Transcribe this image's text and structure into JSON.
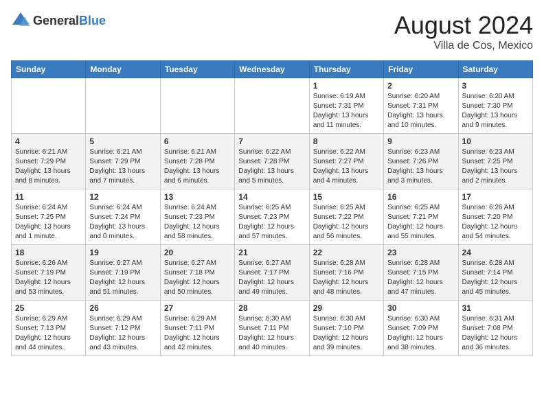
{
  "header": {
    "logo_general": "General",
    "logo_blue": "Blue",
    "title": "August 2024",
    "subtitle": "Villa de Cos, Mexico"
  },
  "days_of_week": [
    "Sunday",
    "Monday",
    "Tuesday",
    "Wednesday",
    "Thursday",
    "Friday",
    "Saturday"
  ],
  "weeks": [
    [
      {
        "day": "",
        "info": ""
      },
      {
        "day": "",
        "info": ""
      },
      {
        "day": "",
        "info": ""
      },
      {
        "day": "",
        "info": ""
      },
      {
        "day": "1",
        "info": "Sunrise: 6:19 AM\nSunset: 7:31 PM\nDaylight: 13 hours and 11 minutes."
      },
      {
        "day": "2",
        "info": "Sunrise: 6:20 AM\nSunset: 7:31 PM\nDaylight: 13 hours and 10 minutes."
      },
      {
        "day": "3",
        "info": "Sunrise: 6:20 AM\nSunset: 7:30 PM\nDaylight: 13 hours and 9 minutes."
      }
    ],
    [
      {
        "day": "4",
        "info": "Sunrise: 6:21 AM\nSunset: 7:29 PM\nDaylight: 13 hours and 8 minutes."
      },
      {
        "day": "5",
        "info": "Sunrise: 6:21 AM\nSunset: 7:29 PM\nDaylight: 13 hours and 7 minutes."
      },
      {
        "day": "6",
        "info": "Sunrise: 6:21 AM\nSunset: 7:28 PM\nDaylight: 13 hours and 6 minutes."
      },
      {
        "day": "7",
        "info": "Sunrise: 6:22 AM\nSunset: 7:28 PM\nDaylight: 13 hours and 5 minutes."
      },
      {
        "day": "8",
        "info": "Sunrise: 6:22 AM\nSunset: 7:27 PM\nDaylight: 13 hours and 4 minutes."
      },
      {
        "day": "9",
        "info": "Sunrise: 6:23 AM\nSunset: 7:26 PM\nDaylight: 13 hours and 3 minutes."
      },
      {
        "day": "10",
        "info": "Sunrise: 6:23 AM\nSunset: 7:25 PM\nDaylight: 13 hours and 2 minutes."
      }
    ],
    [
      {
        "day": "11",
        "info": "Sunrise: 6:24 AM\nSunset: 7:25 PM\nDaylight: 13 hours and 1 minute."
      },
      {
        "day": "12",
        "info": "Sunrise: 6:24 AM\nSunset: 7:24 PM\nDaylight: 13 hours and 0 minutes."
      },
      {
        "day": "13",
        "info": "Sunrise: 6:24 AM\nSunset: 7:23 PM\nDaylight: 12 hours and 58 minutes."
      },
      {
        "day": "14",
        "info": "Sunrise: 6:25 AM\nSunset: 7:23 PM\nDaylight: 12 hours and 57 minutes."
      },
      {
        "day": "15",
        "info": "Sunrise: 6:25 AM\nSunset: 7:22 PM\nDaylight: 12 hours and 56 minutes."
      },
      {
        "day": "16",
        "info": "Sunrise: 6:25 AM\nSunset: 7:21 PM\nDaylight: 12 hours and 55 minutes."
      },
      {
        "day": "17",
        "info": "Sunrise: 6:26 AM\nSunset: 7:20 PM\nDaylight: 12 hours and 54 minutes."
      }
    ],
    [
      {
        "day": "18",
        "info": "Sunrise: 6:26 AM\nSunset: 7:19 PM\nDaylight: 12 hours and 53 minutes."
      },
      {
        "day": "19",
        "info": "Sunrise: 6:27 AM\nSunset: 7:19 PM\nDaylight: 12 hours and 51 minutes."
      },
      {
        "day": "20",
        "info": "Sunrise: 6:27 AM\nSunset: 7:18 PM\nDaylight: 12 hours and 50 minutes."
      },
      {
        "day": "21",
        "info": "Sunrise: 6:27 AM\nSunset: 7:17 PM\nDaylight: 12 hours and 49 minutes."
      },
      {
        "day": "22",
        "info": "Sunrise: 6:28 AM\nSunset: 7:16 PM\nDaylight: 12 hours and 48 minutes."
      },
      {
        "day": "23",
        "info": "Sunrise: 6:28 AM\nSunset: 7:15 PM\nDaylight: 12 hours and 47 minutes."
      },
      {
        "day": "24",
        "info": "Sunrise: 6:28 AM\nSunset: 7:14 PM\nDaylight: 12 hours and 45 minutes."
      }
    ],
    [
      {
        "day": "25",
        "info": "Sunrise: 6:29 AM\nSunset: 7:13 PM\nDaylight: 12 hours and 44 minutes."
      },
      {
        "day": "26",
        "info": "Sunrise: 6:29 AM\nSunset: 7:12 PM\nDaylight: 12 hours and 43 minutes."
      },
      {
        "day": "27",
        "info": "Sunrise: 6:29 AM\nSunset: 7:11 PM\nDaylight: 12 hours and 42 minutes."
      },
      {
        "day": "28",
        "info": "Sunrise: 6:30 AM\nSunset: 7:11 PM\nDaylight: 12 hours and 40 minutes."
      },
      {
        "day": "29",
        "info": "Sunrise: 6:30 AM\nSunset: 7:10 PM\nDaylight: 12 hours and 39 minutes."
      },
      {
        "day": "30",
        "info": "Sunrise: 6:30 AM\nSunset: 7:09 PM\nDaylight: 12 hours and 38 minutes."
      },
      {
        "day": "31",
        "info": "Sunrise: 6:31 AM\nSunset: 7:08 PM\nDaylight: 12 hours and 36 minutes."
      }
    ]
  ],
  "shaded_weeks": [
    1,
    3
  ],
  "colors": {
    "header_bg": "#3a7abf",
    "shaded_cell": "#f2f2f2"
  }
}
